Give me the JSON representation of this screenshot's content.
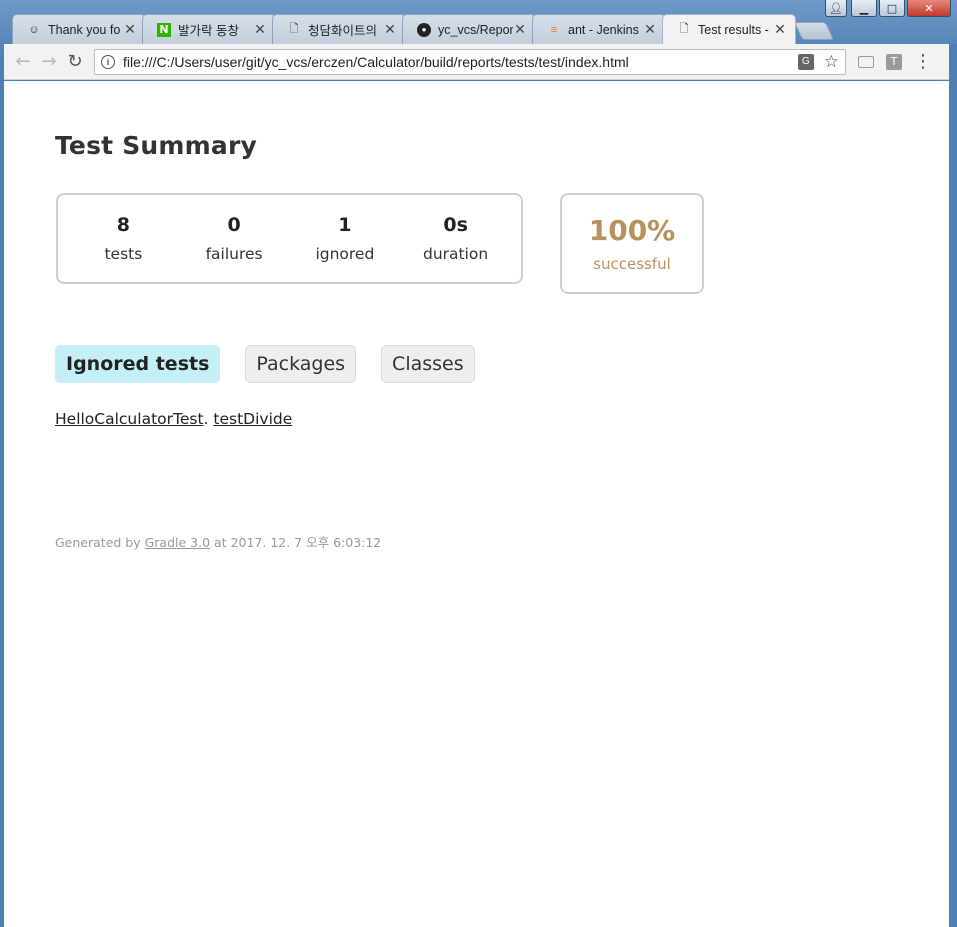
{
  "browser": {
    "tabs": [
      {
        "title": "Thank you fo",
        "icon": "jenkins-icon",
        "active": false
      },
      {
        "title": "발가락 동창",
        "icon": "naver-icon",
        "active": false
      },
      {
        "title": "청담화이트의",
        "icon": "page-icon",
        "active": false
      },
      {
        "title": "yc_vcs/Repor",
        "icon": "github-icon",
        "active": false
      },
      {
        "title": "ant - Jenkins",
        "icon": "stackoverflow-icon",
        "active": false
      },
      {
        "title": "Test results -",
        "icon": "page-icon",
        "active": true
      }
    ],
    "url": "file:///C:/Users/user/git/yc_vcs/erczen/Calculator/build/reports/tests/test/index.html",
    "extension_t_label": "T"
  },
  "page": {
    "title": "Test Summary",
    "counters": [
      {
        "value": "8",
        "label": "tests"
      },
      {
        "value": "0",
        "label": "failures"
      },
      {
        "value": "1",
        "label": "ignored"
      },
      {
        "value": "0s",
        "label": "duration"
      }
    ],
    "success": {
      "percent": "100%",
      "label": "successful"
    },
    "tabs": [
      {
        "label": "Ignored tests",
        "selected": true
      },
      {
        "label": "Packages",
        "selected": false
      },
      {
        "label": "Classes",
        "selected": false
      }
    ],
    "ignored": {
      "class_link": "HelloCalculatorTest",
      "separator": ".",
      "method_link": "testDivide"
    },
    "footer": {
      "prefix": "Generated by",
      "gradle_link": "Gradle 3.0",
      "suffix": "at 2017. 12. 7 오후 6:03:12"
    }
  },
  "colors": {
    "success": "#b6935a",
    "selected_tab": "#c5eff6"
  }
}
